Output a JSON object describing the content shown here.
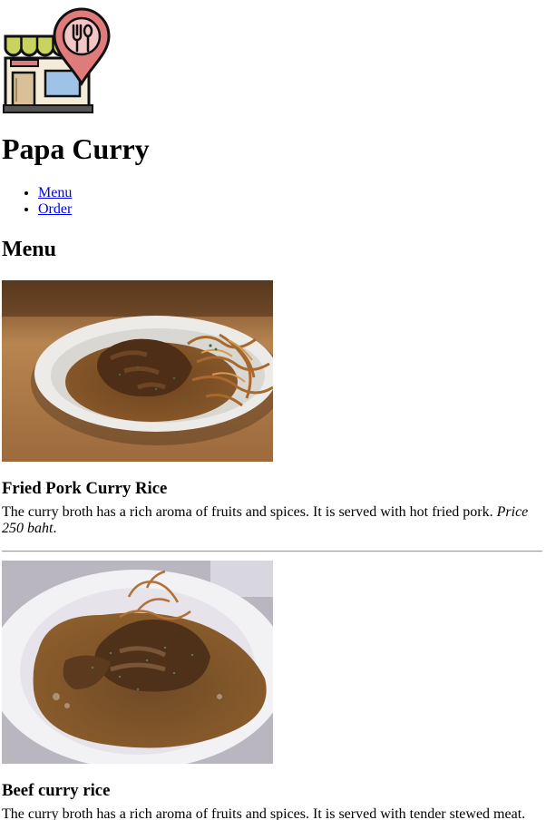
{
  "site": {
    "title": "Papa Curry",
    "logo_icon": "restaurant-location-icon"
  },
  "nav": {
    "items": [
      {
        "label": "Menu"
      },
      {
        "label": "Order"
      }
    ]
  },
  "menu": {
    "heading": "Menu",
    "items": [
      {
        "name": "Fried Pork Curry Rice",
        "description": "The curry broth has a rich aroma of fruits and spices. It is served with hot fried pork. ",
        "price": "Price 250 baht",
        "price_suffix": ".",
        "image": "fried-pork-curry-photo"
      },
      {
        "name": "Beef curry rice",
        "description": "The curry broth has a rich aroma of fruits and spices. It is served with tender stewed meat.",
        "image": "beef-curry-photo"
      }
    ]
  },
  "colors": {
    "link": "#0000ee",
    "curry": "#7a4e1e",
    "table": "#c9955a"
  }
}
